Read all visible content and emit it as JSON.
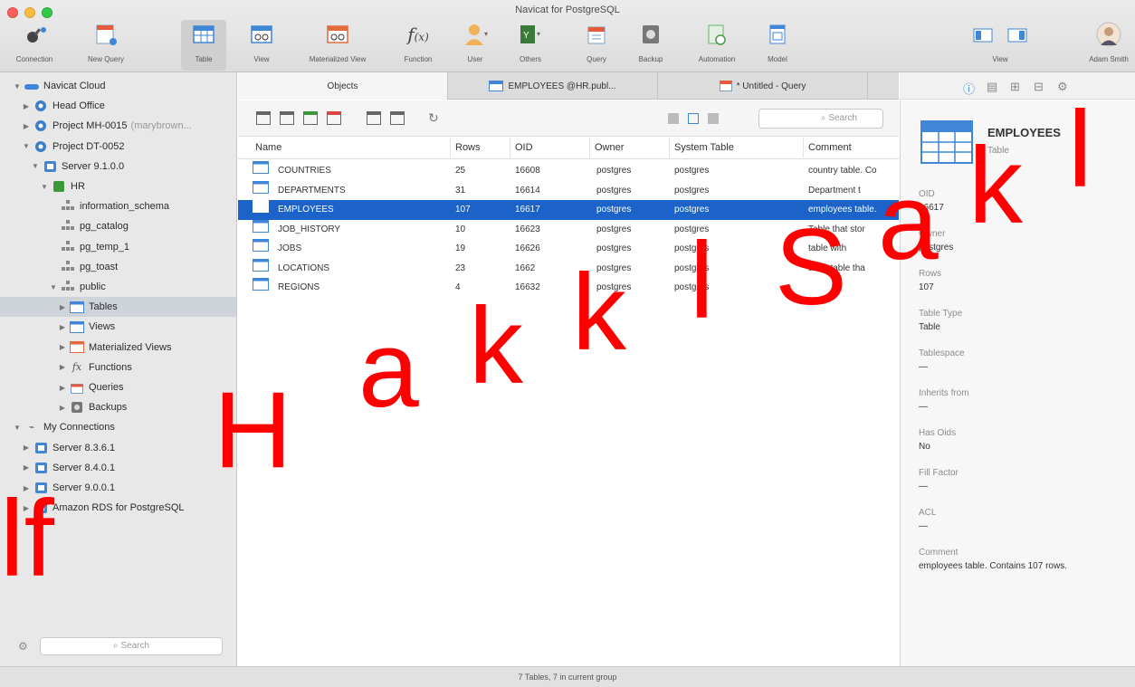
{
  "window": {
    "title": "Navicat for PostgreSQL"
  },
  "toolbar": {
    "connection": "Connection",
    "new_query": "New Query",
    "table": "Table",
    "view": "View",
    "materialized_view": "Materialized View",
    "function": "Function",
    "user": "User",
    "others": "Others",
    "query": "Query",
    "backup": "Backup",
    "automation": "Automation",
    "model": "Model",
    "view_toggle": "View",
    "account": "Adam Smith"
  },
  "sidebar": {
    "items": [
      {
        "label": "Navicat Cloud",
        "icon": "cloud-icon",
        "level": 0,
        "expanded": true
      },
      {
        "label": "Head Office",
        "icon": "project-icon",
        "level": 1,
        "expanded": false
      },
      {
        "label": "Project MH-0015",
        "suffix": "(marybrown...",
        "icon": "project-icon",
        "level": 1,
        "expanded": false
      },
      {
        "label": "Project DT-0052",
        "icon": "project-icon",
        "level": 1,
        "expanded": true
      },
      {
        "label": "Server 9.1.0.0",
        "icon": "server-icon",
        "level": 2,
        "expanded": true
      },
      {
        "label": "HR",
        "icon": "database-icon",
        "level": 3,
        "expanded": true
      },
      {
        "label": "information_schema",
        "icon": "schema-icon",
        "level": 4
      },
      {
        "label": "pg_catalog",
        "icon": "schema-icon",
        "level": 4
      },
      {
        "label": "pg_temp_1",
        "icon": "schema-icon",
        "level": 4
      },
      {
        "label": "pg_toast",
        "icon": "schema-icon",
        "level": 4
      },
      {
        "label": "public",
        "icon": "schema-icon",
        "level": 4,
        "expanded": true
      },
      {
        "label": "Tables",
        "icon": "table-icon",
        "level": 5,
        "selected": true
      },
      {
        "label": "Views",
        "icon": "view-icon",
        "level": 5
      },
      {
        "label": "Materialized Views",
        "icon": "materialized-view-icon",
        "level": 5
      },
      {
        "label": "Functions",
        "icon": "function-icon",
        "level": 5
      },
      {
        "label": "Queries",
        "icon": "query-icon",
        "level": 5
      },
      {
        "label": "Backups",
        "icon": "backup-icon",
        "level": 5
      },
      {
        "label": "My Connections",
        "icon": "connections-icon",
        "level": 0,
        "expanded": true
      },
      {
        "label": "Server 8.3.6.1",
        "icon": "server-icon",
        "level": 1
      },
      {
        "label": "Server 8.4.0.1",
        "icon": "server-icon",
        "level": 1
      },
      {
        "label": "Server 9.0.0.1",
        "icon": "server-icon",
        "level": 1
      },
      {
        "label": "Amazon RDS for PostgreSQL",
        "icon": "server-icon",
        "level": 1
      }
    ],
    "search_placeholder": "Search"
  },
  "tabs": [
    {
      "label": "Objects",
      "active": true
    },
    {
      "label": "EMPLOYEES @HR.publ...",
      "active": false
    },
    {
      "label": "* Untitled - Query",
      "active": false
    }
  ],
  "objects": {
    "search_placeholder": "Search",
    "columns": [
      "Name",
      "Rows",
      "OID",
      "Owner",
      "System Table",
      "Comment"
    ],
    "rows": [
      {
        "name": "COUNTRIES",
        "rows": "25",
        "oid": "16608",
        "owner": "postgres",
        "system": "postgres",
        "comment": "country table. Co"
      },
      {
        "name": "DEPARTMENTS",
        "rows": "31",
        "oid": "16614",
        "owner": "postgres",
        "system": "postgres",
        "comment": "Department t"
      },
      {
        "name": "EMPLOYEES",
        "rows": "107",
        "oid": "16617",
        "owner": "postgres",
        "system": "postgres",
        "comment": "employees table.",
        "selected": true
      },
      {
        "name": "JOB_HISTORY",
        "rows": "10",
        "oid": "16623",
        "owner": "postgres",
        "system": "postgres",
        "comment": "Table that stor"
      },
      {
        "name": "JOBS",
        "rows": "19",
        "oid": "16626",
        "owner": "postgres",
        "system": "postgres",
        "comment": "table with"
      },
      {
        "name": "LOCATIONS",
        "rows": "23",
        "oid": "1662",
        "owner": "postgres",
        "system": "postgres",
        "comment": "ation table tha"
      },
      {
        "name": "REGIONS",
        "rows": "4",
        "oid": "16632",
        "owner": "postgres",
        "system": "postgres",
        "comment": ""
      }
    ]
  },
  "info": {
    "name": "EMPLOYEES",
    "type_sub": "Table",
    "fields": [
      {
        "label": "OID",
        "value": "16617"
      },
      {
        "label": "Owner",
        "value": "postgres"
      },
      {
        "label": "Rows",
        "value": "107"
      },
      {
        "label": "Table Type",
        "value": "Table"
      },
      {
        "label": "Tablespace",
        "value": "—"
      },
      {
        "label": "Inherits from",
        "value": "—"
      },
      {
        "label": "Has Oids",
        "value": "No"
      },
      {
        "label": "Fill Factor",
        "value": "—"
      },
      {
        "label": "ACL",
        "value": "—"
      },
      {
        "label": "Comment",
        "value": "employees table. Contains 107 rows."
      }
    ]
  },
  "status": {
    "text": "7 Tables, 7 in current group"
  },
  "watermark": {
    "chars": [
      "lf",
      "H",
      "a",
      "k",
      "k",
      "l",
      "S",
      "a",
      "k",
      "l"
    ],
    "color": "#ff0000"
  }
}
